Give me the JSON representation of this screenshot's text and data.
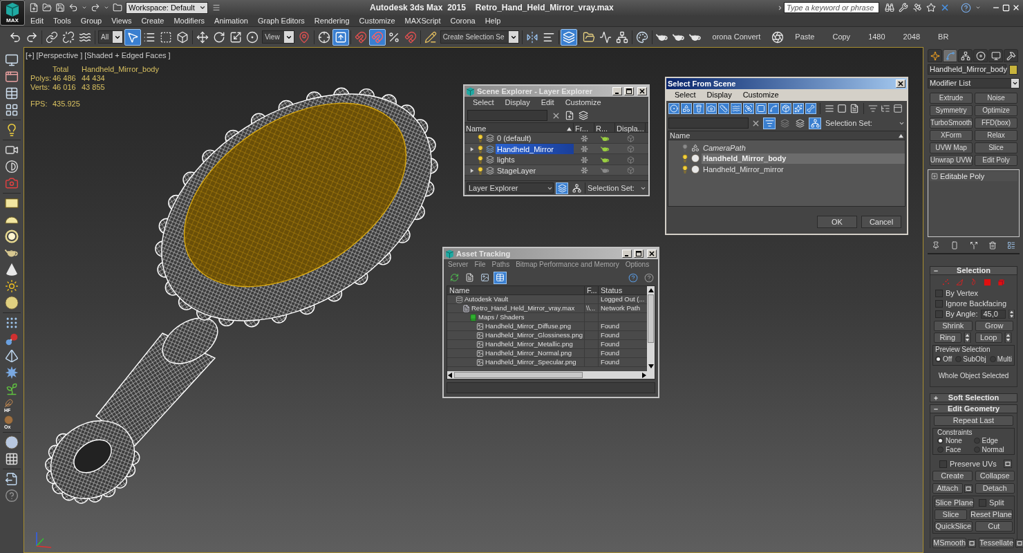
{
  "title_bar": {
    "app_button": "MAX",
    "workspace": "Workspace: Default",
    "app_title": "Autodesk 3ds Max  2015",
    "file_name": "Retro_Hand_Held_Mirror_vray.max",
    "search": {
      "placeholder": "Type a keyword or phrase"
    }
  },
  "menu_bar": [
    "Edit",
    "Tools",
    "Group",
    "Views",
    "Create",
    "Modifiers",
    "Animation",
    "Graph Editors",
    "Rendering",
    "Customize",
    "MAXScript",
    "Corona",
    "Help"
  ],
  "main_toolbar": {
    "groups": [
      [
        {
          "kind": "tool",
          "active": false
        },
        {
          "kind": "tool",
          "active": false
        }
      ],
      [
        {
          "kind": "tool",
          "active": false
        },
        {
          "kind": "tool",
          "active": false
        },
        {
          "kind": "tool",
          "active": false
        }
      ],
      [
        {
          "kind": "dropdown",
          "value": "All"
        },
        {
          "kind": "tool",
          "active": true
        },
        {
          "kind": "tool",
          "active": false
        },
        {
          "kind": "tool",
          "active": false
        },
        {
          "kind": "tool",
          "active": false
        }
      ],
      [
        {
          "kind": "tool",
          "active": false
        },
        {
          "kind": "tool",
          "active": false
        },
        {
          "kind": "tool",
          "active": false
        },
        {
          "kind": "tool",
          "active": false
        },
        {
          "kind": "dropdown",
          "value": "View"
        },
        {
          "kind": "tool",
          "active": false
        }
      ],
      [
        {
          "kind": "tool",
          "active": false
        },
        {
          "kind": "tool",
          "active": true
        }
      ],
      [
        {
          "kind": "tool",
          "active": false
        },
        {
          "kind": "tool",
          "active": true
        },
        {
          "kind": "tool",
          "active": false
        },
        {
          "kind": "tool",
          "active": false
        }
      ],
      [
        {
          "kind": "tool",
          "active": false
        },
        {
          "kind": "dropdown",
          "value": "Create Selection Se"
        }
      ],
      [
        {
          "kind": "tool",
          "active": false
        },
        {
          "kind": "tool",
          "active": false
        }
      ],
      [
        {
          "kind": "tool",
          "active": true
        }
      ],
      [
        {
          "kind": "tool",
          "active": false
        },
        {
          "kind": "tool",
          "active": false
        },
        {
          "kind": "tool",
          "active": false
        }
      ],
      [
        {
          "kind": "tool",
          "active": false
        }
      ],
      [
        {
          "kind": "tool",
          "active": false
        },
        {
          "kind": "tool",
          "active": false
        },
        {
          "kind": "tool",
          "active": false
        },
        {
          "kind": "text",
          "label": "orona Convert"
        },
        {
          "kind": "tool",
          "active": false
        },
        {
          "kind": "text",
          "label": "Paste"
        },
        {
          "kind": "text",
          "label": "Copy"
        },
        {
          "kind": "text",
          "label": "1480"
        },
        {
          "kind": "text",
          "label": "2048"
        },
        {
          "kind": "text",
          "label": "BR"
        }
      ]
    ]
  },
  "left_toolbar": {
    "captions": [
      "HF",
      "Ox"
    ]
  },
  "viewport": {
    "labels": [
      "[+]",
      "[Perspective ]",
      "[Shaded + Edged Faces ]"
    ],
    "stats": {
      "headers": [
        "Total",
        "Handheld_Mirror_body"
      ],
      "rows": [
        {
          "label": "Polys:",
          "values": [
            "46 486",
            "44 434"
          ]
        },
        {
          "label": "Verts:",
          "values": [
            "46 016",
            "43 855"
          ]
        }
      ],
      "fps": {
        "label": "FPS:",
        "value": "435.925"
      }
    }
  },
  "scene_explorer": {
    "title": "Scene Explorer - Layer Explorer",
    "focused": false,
    "menu": [
      "Select",
      "Display",
      "Edit",
      "Customize"
    ],
    "columns": [
      "Name",
      "Fr...",
      "R...",
      "Displa..."
    ],
    "rows": [
      {
        "name": "0 (default)",
        "expandable": false,
        "selected": false,
        "renderable": true
      },
      {
        "name": "Handheld_Mirror",
        "expandable": true,
        "selected": true,
        "renderable": true
      },
      {
        "name": "lights",
        "expandable": false,
        "selected": false,
        "renderable": true
      },
      {
        "name": "StageLayer",
        "expandable": true,
        "selected": false,
        "renderable": false
      }
    ],
    "explorer_type": "Layer Explorer",
    "view_tools": [
      {
        "active": true
      },
      {
        "active": false
      }
    ],
    "selection_set": "Selection Set:"
  },
  "select_from_scene": {
    "title": "Select From Scene",
    "focused": true,
    "menu": [
      "Select",
      "Display",
      "Customize"
    ],
    "filters": [
      {
        "active": true
      },
      {
        "active": true
      },
      {
        "active": true
      },
      {
        "active": true
      },
      {
        "active": true
      },
      {
        "active": true
      },
      {
        "active": true
      },
      {
        "active": true
      },
      {
        "active": true
      },
      {
        "active": true
      },
      {
        "active": true
      },
      {
        "active": true
      }
    ],
    "search_tools": [
      {
        "active": true
      },
      {
        "active": false
      },
      {
        "active": false
      },
      {
        "active": true
      }
    ],
    "selection_set": "Selection Set:",
    "column": "Name",
    "rows": [
      {
        "name": "CameraPath",
        "kind": "shape",
        "hidden": true,
        "selected": false
      },
      {
        "name": "Handheld_Mirror_body",
        "kind": "geometry",
        "hidden": false,
        "selected": true
      },
      {
        "name": "Handheld_Mirror_mirror",
        "kind": "geometry",
        "hidden": false,
        "selected": false
      }
    ],
    "buttons": [
      "OK",
      "Cancel"
    ]
  },
  "asset_tracking": {
    "title": "Asset Tracking",
    "focused": false,
    "menu": [
      "Server",
      "File",
      "Paths",
      "Bitmap Performance and Memory",
      "Options"
    ],
    "tools": [
      {
        "active": false
      },
      {
        "active": false
      },
      {
        "active": false
      },
      {
        "active": true
      }
    ],
    "columns": [
      "Name",
      "F...",
      "Status"
    ],
    "tree": [
      {
        "kind": "vault",
        "name": "Autodesk Vault",
        "status": "Logged Out (...",
        "children": [
          {
            "kind": "scene_file",
            "name": "Retro_Hand_Held_Mirror_vray.max",
            "path": "\\\\...",
            "status": "Network Path",
            "children": [
              {
                "kind": "folder",
                "name": "Maps / Shaders",
                "children": [
                  {
                    "kind": "bitmap",
                    "name": "Handheld_Mirror_Diffuse.png",
                    "status": "Found"
                  },
                  {
                    "kind": "bitmap",
                    "name": "Handheld_Mirror_Glossiness.png",
                    "status": "Found"
                  },
                  {
                    "kind": "bitmap",
                    "name": "Handheld_Mirror_Metallic.png",
                    "status": "Found"
                  },
                  {
                    "kind": "bitmap",
                    "name": "Handheld_Mirror_Normal.png",
                    "status": "Found"
                  },
                  {
                    "kind": "bitmap",
                    "name": "Handheld_Mirror_Specular.png",
                    "status": "Found"
                  }
                ]
              }
            ]
          }
        ]
      }
    ]
  },
  "command_panel": {
    "tabs": [
      {
        "selected": false
      },
      {
        "selected": true
      },
      {
        "selected": false
      },
      {
        "selected": false
      },
      {
        "selected": false
      },
      {
        "selected": false
      }
    ],
    "object_name": "Handheld_Mirror_body",
    "modifier_list": "Modifier List",
    "modifier_buttons": [
      "Extrude",
      "Noise",
      "Symmetry",
      "Optimize",
      "TurboSmooth",
      "FFD(box)",
      "XForm",
      "Relax",
      "UVW Map",
      "Slice",
      "Unwrap UVW",
      "Edit Poly"
    ],
    "stack": [
      {
        "name": "Editable Poly",
        "expanded": false
      }
    ],
    "selection": {
      "title": "Selection",
      "expanded": true,
      "subobject_levels": [
        {
          "selected": false
        },
        {
          "selected": false
        },
        {
          "selected": false
        },
        {
          "selected": false
        },
        {
          "selected": false
        }
      ],
      "checkboxes": [
        {
          "label": "By Vertex",
          "checked": false
        },
        {
          "label": "Ignore Backfacing",
          "checked": false
        },
        {
          "label": "By Angle:",
          "checked": false,
          "value": "45,0"
        }
      ],
      "grow_buttons": [
        "Shrink",
        "Grow"
      ],
      "loop_buttons": [
        "Ring",
        "Loop"
      ],
      "preview": {
        "title": "Preview Selection",
        "options": [
          {
            "label": "Off",
            "selected": true
          },
          {
            "label": "SubObj",
            "selected": false
          },
          {
            "label": "Multi",
            "selected": false
          }
        ]
      },
      "status": "Whole Object Selected"
    },
    "soft_selection": {
      "title": "Soft Selection",
      "expanded": false
    },
    "edit_geometry": {
      "title": "Edit Geometry",
      "expanded": true,
      "repeat_last": "Repeat Last",
      "constraints": {
        "title": "Constraints",
        "options": [
          {
            "label": "None",
            "selected": true
          },
          {
            "label": "Edge",
            "selected": false
          },
          {
            "label": "Face",
            "selected": false
          },
          {
            "label": "Normal",
            "selected": false
          }
        ]
      },
      "preserve_uvs": {
        "label": "Preserve UVs",
        "checked": false
      },
      "rows": [
        [
          {
            "kind": "button",
            "label": "Create",
            "has_settings": false
          },
          {
            "kind": "button",
            "label": "Collapse",
            "has_settings": false
          }
        ],
        [
          {
            "kind": "button",
            "label": "Attach",
            "has_settings": true
          },
          {
            "kind": "button",
            "label": "Detach",
            "has_settings": false
          }
        ]
      ],
      "slice_rows": [
        [
          {
            "kind": "button",
            "label": "Slice Plane",
            "has_settings": false
          },
          {
            "kind": "checkbox",
            "label": "Split",
            "checked": false
          }
        ],
        [
          {
            "kind": "button",
            "label": "Slice",
            "has_settings": false
          },
          {
            "kind": "button",
            "label": "Reset Plane",
            "has_settings": false
          }
        ],
        [
          {
            "kind": "button",
            "label": "QuickSlice",
            "has_settings": false
          },
          {
            "kind": "button",
            "label": "Cut",
            "has_settings": false
          }
        ]
      ],
      "bottom_rows": [
        [
          {
            "kind": "button",
            "label": "MSmooth",
            "has_settings": true
          },
          {
            "kind": "button",
            "label": "Tessellate",
            "has_settings": true
          }
        ]
      ]
    }
  }
}
